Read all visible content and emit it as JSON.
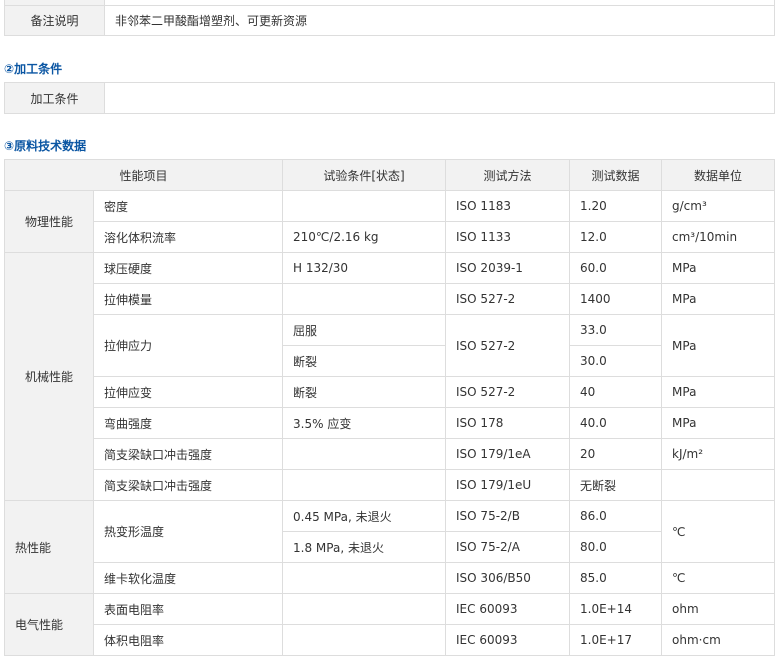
{
  "remarks": {
    "label": "备注说明",
    "value": "非邻苯二甲酸酯增塑剂、可更新资源"
  },
  "processing": {
    "heading": "②加工条件",
    "label": "加工条件",
    "value": ""
  },
  "tech": {
    "heading": "③原料技术数据",
    "headers": [
      "性能项目",
      "试验条件[状态]",
      "测试方法",
      "测试数据",
      "数据单位"
    ],
    "categories": {
      "physical": "物理性能",
      "mechanical": "机械性能",
      "thermal": "热性能",
      "electrical": "电气性能"
    },
    "rows": {
      "density": {
        "prop": "密度",
        "cond": "",
        "method": "ISO 1183",
        "value": "1.20",
        "unit": "g/cm³"
      },
      "mfr": {
        "prop": "溶化体积流率",
        "cond": "210℃/2.16 kg",
        "method": "ISO 1133",
        "value": "12.0",
        "unit": "cm³/10min"
      },
      "hardness": {
        "prop": "球压硬度",
        "cond": "H 132/30",
        "method": "ISO 2039-1",
        "value": "60.0",
        "unit": "MPa"
      },
      "modulus": {
        "prop": "拉伸模量",
        "cond": "",
        "method": "ISO 527-2",
        "value": "1400",
        "unit": "MPa"
      },
      "stress": {
        "prop": "拉伸应力",
        "cond1": "屈服",
        "cond2": "断裂",
        "method": "ISO 527-2",
        "value1": "33.0",
        "value2": "30.0",
        "unit": "MPa"
      },
      "strain": {
        "prop": "拉伸应变",
        "cond": "断裂",
        "method": "ISO 527-2",
        "value": "40",
        "unit": "MPa"
      },
      "flex": {
        "prop": "弯曲强度",
        "cond": "3.5% 应变",
        "method": "ISO 178",
        "value": "40.0",
        "unit": "MPa"
      },
      "impact1": {
        "prop": "简支梁缺口冲击强度",
        "cond": "",
        "method": "ISO 179/1eA",
        "value": "20",
        "unit": "kJ/m²"
      },
      "impact2": {
        "prop": "简支梁缺口冲击强度",
        "cond": "",
        "method": "ISO 179/1eU",
        "value": "无断裂",
        "unit": ""
      },
      "hdt": {
        "prop": "热变形温度",
        "cond1": "0.45 MPa, 未退火",
        "cond2": "1.8 MPa, 未退火",
        "method1": "ISO 75-2/B",
        "method2": "ISO 75-2/A",
        "value1": "86.0",
        "value2": "80.0",
        "unit": "℃"
      },
      "vicat": {
        "prop": "维卡软化温度",
        "cond": "",
        "method": "ISO 306/B50",
        "value": "85.0",
        "unit": "℃"
      },
      "surface": {
        "prop": "表面电阻率",
        "cond": "",
        "method": "IEC 60093",
        "value": "1.0E+14",
        "unit": "ohm"
      },
      "volume": {
        "prop": "体积电阻率",
        "cond": "",
        "method": "IEC 60093",
        "value": "1.0E+17",
        "unit": "ohm·cm"
      }
    }
  }
}
